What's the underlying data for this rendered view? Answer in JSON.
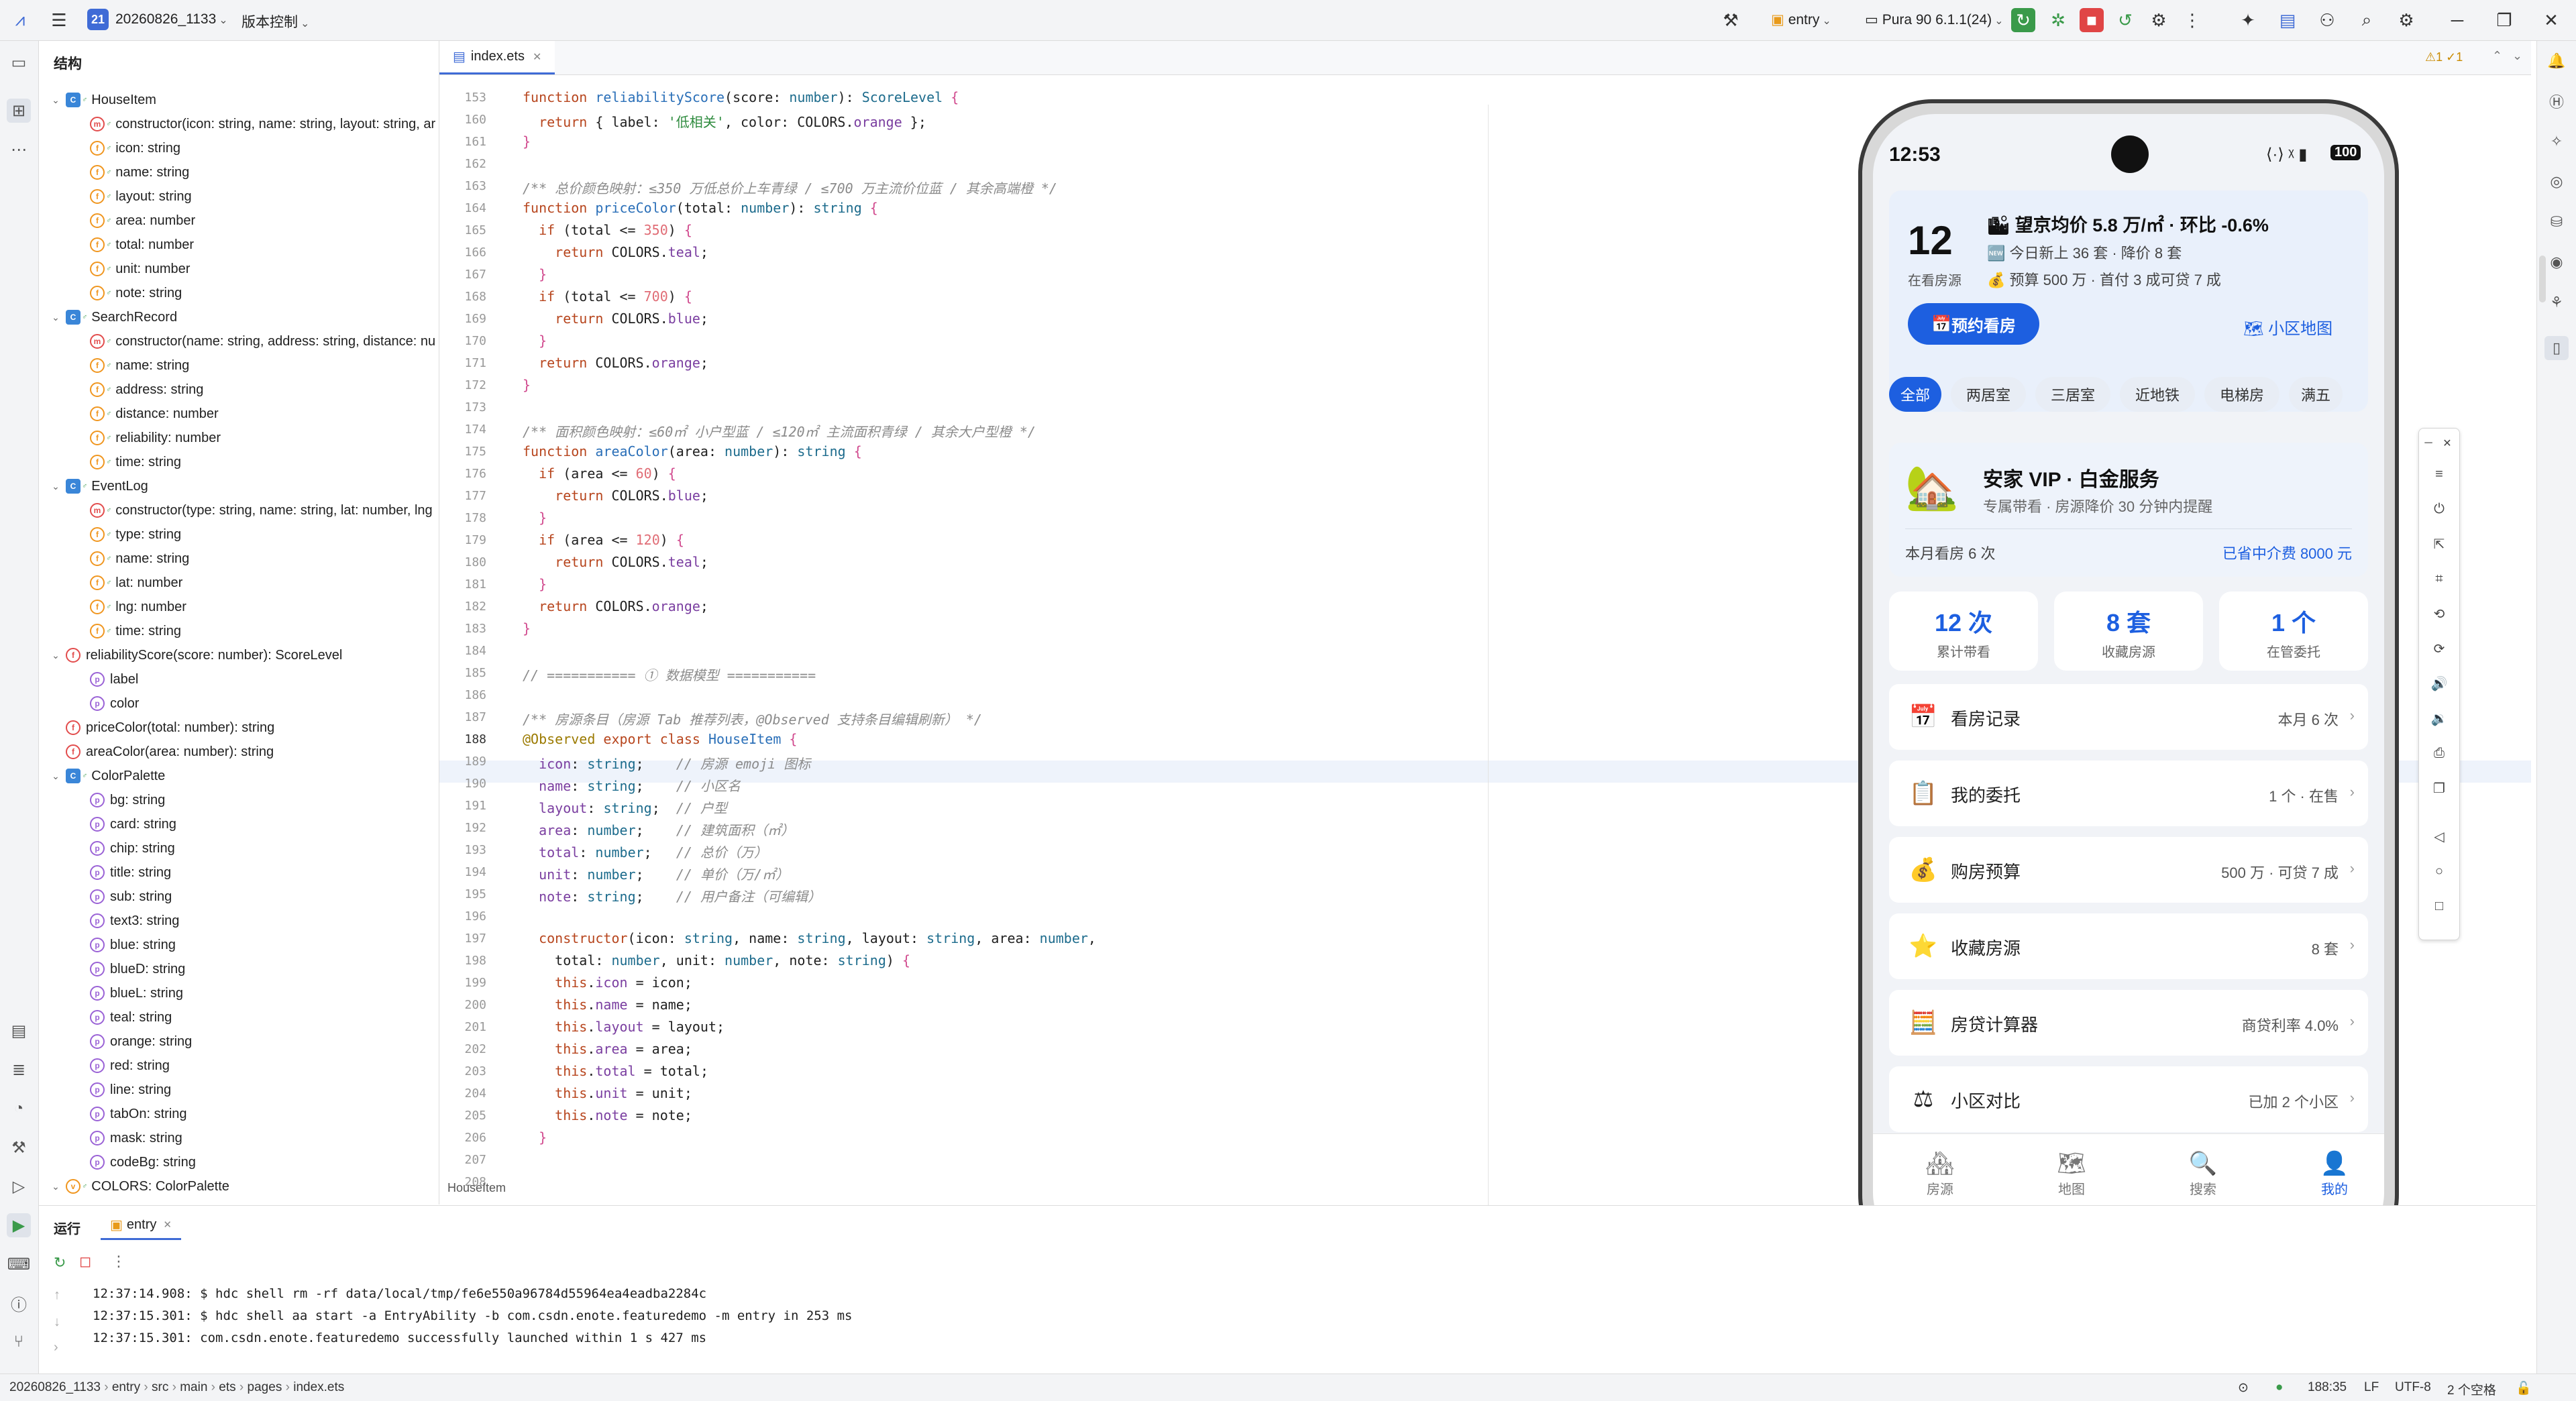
{
  "titlebar": {
    "project_badge": "21",
    "project_name": "20260826_1133",
    "vcs": "版本控制",
    "module": "entry",
    "device": "Pura 90 6.1.1(24)"
  },
  "structure": {
    "title": "结构",
    "items": [
      {
        "label": "HouseItem",
        "kind": "class",
        "indent": 0,
        "arrow": "⌄"
      },
      {
        "label": "constructor(icon: string, name: string, layout: string, ar",
        "kind": "m",
        "indent": 1
      },
      {
        "label": "icon: string",
        "kind": "f",
        "indent": 1
      },
      {
        "label": "name: string",
        "kind": "f",
        "indent": 1
      },
      {
        "label": "layout: string",
        "kind": "f",
        "indent": 1
      },
      {
        "label": "area: number",
        "kind": "f",
        "indent": 1
      },
      {
        "label": "total: number",
        "kind": "f",
        "indent": 1
      },
      {
        "label": "unit: number",
        "kind": "f",
        "indent": 1
      },
      {
        "label": "note: string",
        "kind": "f",
        "indent": 1
      },
      {
        "label": "SearchRecord",
        "kind": "class",
        "indent": 0,
        "arrow": "⌄"
      },
      {
        "label": "constructor(name: string, address: string, distance: nu",
        "kind": "m",
        "indent": 1
      },
      {
        "label": "name: string",
        "kind": "f",
        "indent": 1
      },
      {
        "label": "address: string",
        "kind": "f",
        "indent": 1
      },
      {
        "label": "distance: number",
        "kind": "f",
        "indent": 1
      },
      {
        "label": "reliability: number",
        "kind": "f",
        "indent": 1
      },
      {
        "label": "time: string",
        "kind": "f",
        "indent": 1
      },
      {
        "label": "EventLog",
        "kind": "class",
        "indent": 0,
        "arrow": "⌄"
      },
      {
        "label": "constructor(type: string, name: string, lat: number, lng",
        "kind": "m",
        "indent": 1
      },
      {
        "label": "type: string",
        "kind": "f",
        "indent": 1
      },
      {
        "label": "name: string",
        "kind": "f",
        "indent": 1
      },
      {
        "label": "lat: number",
        "kind": "f",
        "indent": 1
      },
      {
        "label": "lng: number",
        "kind": "f",
        "indent": 1
      },
      {
        "label": "time: string",
        "kind": "f",
        "indent": 1
      },
      {
        "label": "reliabilityScore(score: number): ScoreLevel",
        "kind": "fn",
        "indent": 0,
        "arrow": "⌄"
      },
      {
        "label": "label",
        "kind": "p",
        "indent": 1
      },
      {
        "label": "color",
        "kind": "p",
        "indent": 1
      },
      {
        "label": "priceColor(total: number): string",
        "kind": "fn",
        "indent": 0
      },
      {
        "label": "areaColor(area: number): string",
        "kind": "fn",
        "indent": 0
      },
      {
        "label": "ColorPalette",
        "kind": "class",
        "indent": 0,
        "arrow": "⌄"
      },
      {
        "label": "bg: string",
        "kind": "p",
        "indent": 1
      },
      {
        "label": "card: string",
        "kind": "p",
        "indent": 1
      },
      {
        "label": "chip: string",
        "kind": "p",
        "indent": 1
      },
      {
        "label": "title: string",
        "kind": "p",
        "indent": 1
      },
      {
        "label": "sub: string",
        "kind": "p",
        "indent": 1
      },
      {
        "label": "text3: string",
        "kind": "p",
        "indent": 1
      },
      {
        "label": "blue: string",
        "kind": "p",
        "indent": 1
      },
      {
        "label": "blueD: string",
        "kind": "p",
        "indent": 1
      },
      {
        "label": "blueL: string",
        "kind": "p",
        "indent": 1
      },
      {
        "label": "teal: string",
        "kind": "p",
        "indent": 1
      },
      {
        "label": "orange: string",
        "kind": "p",
        "indent": 1
      },
      {
        "label": "red: string",
        "kind": "p",
        "indent": 1
      },
      {
        "label": "line: string",
        "kind": "p",
        "indent": 1
      },
      {
        "label": "tabOn: string",
        "kind": "p",
        "indent": 1
      },
      {
        "label": "mask: string",
        "kind": "p",
        "indent": 1
      },
      {
        "label": "codeBg: string",
        "kind": "p",
        "indent": 1
      },
      {
        "label": "COLORS: ColorPalette",
        "kind": "const",
        "indent": 0,
        "arrow": "⌄"
      }
    ]
  },
  "editor": {
    "tab": "index.ets",
    "breadcrumb": "HouseItem",
    "warnings": "⚠1 ✓1",
    "lines": [
      {
        "n": "153",
        "html": "<span class=\"kw\">function</span> <span class=\"fn\">reliabilityScore</span>(score: <span class=\"ty\">number</span>): <span class=\"ty\">ScoreLevel</span> <span class=\"pl\">{</span>"
      },
      {
        "n": "160",
        "html": "  <span class=\"kw\">return</span> { label: <span class=\"str\">'低相关'</span>, color: COLORS.<span class=\"prop\">orange</span> };"
      },
      {
        "n": "161",
        "html": "<span class=\"pl\">}</span>"
      },
      {
        "n": "162",
        "html": ""
      },
      {
        "n": "163",
        "html": "<span class=\"cmt\">/** 总价颜色映射：≤350 万低总价上车青绿 / ≤700 万主流价位蓝 / 其余高端橙 */</span>"
      },
      {
        "n": "164",
        "html": "<span class=\"kw\">function</span> <span class=\"fn\">priceColor</span>(total: <span class=\"ty\">number</span>): <span class=\"ty\">string</span> <span class=\"pl\">{</span>"
      },
      {
        "n": "165",
        "html": "  <span class=\"kw\">if</span> (total &lt;= <span class=\"num\">350</span>) <span class=\"pl\">{</span>"
      },
      {
        "n": "166",
        "html": "    <span class=\"kw\">return</span> COLORS.<span class=\"prop\">teal</span>;"
      },
      {
        "n": "167",
        "html": "  <span class=\"pl\">}</span>"
      },
      {
        "n": "168",
        "html": "  <span class=\"kw\">if</span> (total &lt;= <span class=\"num\">700</span>) <span class=\"pl\">{</span>"
      },
      {
        "n": "169",
        "html": "    <span class=\"kw\">return</span> COLORS.<span class=\"prop\">blue</span>;"
      },
      {
        "n": "170",
        "html": "  <span class=\"pl\">}</span>"
      },
      {
        "n": "171",
        "html": "  <span class=\"kw\">return</span> COLORS.<span class=\"prop\">orange</span>;"
      },
      {
        "n": "172",
        "html": "<span class=\"pl\">}</span>"
      },
      {
        "n": "173",
        "html": ""
      },
      {
        "n": "174",
        "html": "<span class=\"cmt\">/** 面积颜色映射：≤60㎡ 小户型蓝 / ≤120㎡ 主流面积青绿 / 其余大户型橙 */</span>"
      },
      {
        "n": "175",
        "html": "<span class=\"kw\">function</span> <span class=\"fn\">areaColor</span>(area: <span class=\"ty\">number</span>): <span class=\"ty\">string</span> <span class=\"pl\">{</span>"
      },
      {
        "n": "176",
        "html": "  <span class=\"kw\">if</span> (area &lt;= <span class=\"num\">60</span>) <span class=\"pl\">{</span>"
      },
      {
        "n": "177",
        "html": "    <span class=\"kw\">return</span> COLORS.<span class=\"prop\">blue</span>;"
      },
      {
        "n": "178",
        "html": "  <span class=\"pl\">}</span>"
      },
      {
        "n": "179",
        "html": "  <span class=\"kw\">if</span> (area &lt;= <span class=\"num\">120</span>) <span class=\"pl\">{</span>"
      },
      {
        "n": "180",
        "html": "    <span class=\"kw\">return</span> COLORS.<span class=\"prop\">teal</span>;"
      },
      {
        "n": "181",
        "html": "  <span class=\"pl\">}</span>"
      },
      {
        "n": "182",
        "html": "  <span class=\"kw\">return</span> COLORS.<span class=\"prop\">orange</span>;"
      },
      {
        "n": "183",
        "html": "<span class=\"pl\">}</span>"
      },
      {
        "n": "184",
        "html": ""
      },
      {
        "n": "185",
        "html": "<span class=\"cmt\">// =========== ① 数据模型 ===========</span>"
      },
      {
        "n": "186",
        "html": ""
      },
      {
        "n": "187",
        "html": "<span class=\"cmt\">/** 房源条目（房源 Tab 推荐列表，@Observed 支持条目编辑刷新） */</span>"
      },
      {
        "n": "188",
        "html": "<span class=\"dec\">@Observed</span> <span class=\"kw\">export</span> <span class=\"kw\">class</span> <span class=\"fn\">HouseItem</span> <span class=\"pl\">{</span>"
      },
      {
        "n": "189",
        "html": "  <span class=\"prop\">icon</span>: <span class=\"ty\">string</span>;    <span class=\"cmt\">// 房源 emoji 图标</span>"
      },
      {
        "n": "190",
        "html": "  <span class=\"prop\">name</span>: <span class=\"ty\">string</span>;    <span class=\"cmt\">// 小区名</span>"
      },
      {
        "n": "191",
        "html": "  <span class=\"prop\">layout</span>: <span class=\"ty\">string</span>;  <span class=\"cmt\">// 户型</span>"
      },
      {
        "n": "192",
        "html": "  <span class=\"prop\">area</span>: <span class=\"ty\">number</span>;    <span class=\"cmt\">// 建筑面积（㎡）</span>"
      },
      {
        "n": "193",
        "html": "  <span class=\"prop\">total</span>: <span class=\"ty\">number</span>;   <span class=\"cmt\">// 总价（万）</span>"
      },
      {
        "n": "194",
        "html": "  <span class=\"prop\">unit</span>: <span class=\"ty\">number</span>;    <span class=\"cmt\">// 单价（万/㎡）</span>"
      },
      {
        "n": "195",
        "html": "  <span class=\"prop\">note</span>: <span class=\"ty\">string</span>;    <span class=\"cmt\">// 用户备注（可编辑）</span>"
      },
      {
        "n": "196",
        "html": ""
      },
      {
        "n": "197",
        "html": "  <span class=\"kw\">constructor</span>(icon: <span class=\"ty\">string</span>, name: <span class=\"ty\">string</span>, layout: <span class=\"ty\">string</span>, area: <span class=\"ty\">number</span>,"
      },
      {
        "n": "198",
        "html": "    total: <span class=\"ty\">number</span>, unit: <span class=\"ty\">number</span>, note: <span class=\"ty\">string</span>) <span class=\"pl\">{</span>"
      },
      {
        "n": "199",
        "html": "    <span class=\"kw\">this</span>.<span class=\"prop\">icon</span> = icon;"
      },
      {
        "n": "200",
        "html": "    <span class=\"kw\">this</span>.<span class=\"prop\">name</span> = name;"
      },
      {
        "n": "201",
        "html": "    <span class=\"kw\">this</span>.<span class=\"prop\">layout</span> = layout;"
      },
      {
        "n": "202",
        "html": "    <span class=\"kw\">this</span>.<span class=\"prop\">area</span> = area;"
      },
      {
        "n": "203",
        "html": "    <span class=\"kw\">this</span>.<span class=\"prop\">total</span> = total;"
      },
      {
        "n": "204",
        "html": "    <span class=\"kw\">this</span>.<span class=\"prop\">unit</span> = unit;"
      },
      {
        "n": "205",
        "html": "    <span class=\"kw\">this</span>.<span class=\"prop\">note</span> = note;"
      },
      {
        "n": "206",
        "html": "  <span class=\"pl\">}</span>"
      },
      {
        "n": "207",
        "html": ""
      },
      {
        "n": "208",
        "html": ""
      }
    ]
  },
  "run": {
    "tab_run": "运行",
    "tab_entry": "entry",
    "lines": [
      "12:37:14.908: $ hdc shell rm -rf data/local/tmp/fe6e550a96784d55964ea4eadba2284c",
      "12:37:15.301: $ hdc shell aa start -a EntryAbility -b com.csdn.enote.featuredemo -m entry in 253 ms",
      "12:37:15.301: com.csdn.enote.featuredemo successfully launched within 1 s 427 ms"
    ]
  },
  "statusbar": {
    "crumbs": [
      "20260826_1133",
      "entry",
      "src",
      "main",
      "ets",
      "pages",
      "index.ets"
    ],
    "position": "188:35",
    "line_sep": "LF",
    "encoding": "UTF-8",
    "indent": "2 个空格"
  },
  "phone": {
    "time": "12:53",
    "battery": "100",
    "hero": {
      "count": "12",
      "count_label": "在看房源",
      "line1": "望京均价 5.8 万/㎡ · 环比 -0.6%",
      "line2": "今日新上 36 套 · 降价 8 套",
      "line3": "预算 500 万 · 首付 3 成可贷 7 成",
      "book_btn": "预约看房",
      "map_link": "小区地图"
    },
    "chips": [
      "全部",
      "两居室",
      "三居室",
      "近地铁",
      "电梯房",
      "满五"
    ],
    "vip": {
      "title": "安家 VIP · 白金服务",
      "sub": "专属带看 · 房源降价 30 分钟内提醒",
      "left": "本月看房 6 次",
      "right": "已省中介费 8000 元"
    },
    "stats": [
      {
        "value": "12 次",
        "label": "累计带看"
      },
      {
        "value": "8 套",
        "label": "收藏房源"
      },
      {
        "value": "1 个",
        "label": "在管委托"
      }
    ],
    "menu": [
      {
        "icon": "📅",
        "icon_name": "calendar-icon",
        "label": "看房记录",
        "value": "本月 6 次"
      },
      {
        "icon": "📋",
        "icon_name": "clipboard-icon",
        "label": "我的委托",
        "value": "1 个 · 在售"
      },
      {
        "icon": "💰",
        "icon_name": "money-bag-icon",
        "label": "购房预算",
        "value": "500 万 · 可贷 7 成"
      },
      {
        "icon": "⭐",
        "icon_name": "star-icon",
        "label": "收藏房源",
        "value": "8 套"
      },
      {
        "icon": "🧮",
        "icon_name": "abacus-icon",
        "label": "房贷计算器",
        "value": "商贷利率 4.0%"
      },
      {
        "icon": "⚖",
        "icon_name": "scale-icon",
        "label": "小区对比",
        "value": "已加 2 个小区"
      }
    ],
    "tabs": [
      {
        "icon": "🏘",
        "label": "房源"
      },
      {
        "icon": "🗺",
        "label": "地图"
      },
      {
        "icon": "🔍",
        "label": "搜索"
      },
      {
        "icon": "👤",
        "label": "我的"
      }
    ]
  },
  "colors": {
    "accent": "#3f6bd6",
    "phone_blue": "#1d5fe0",
    "chip_active": "#1d5fe0"
  }
}
